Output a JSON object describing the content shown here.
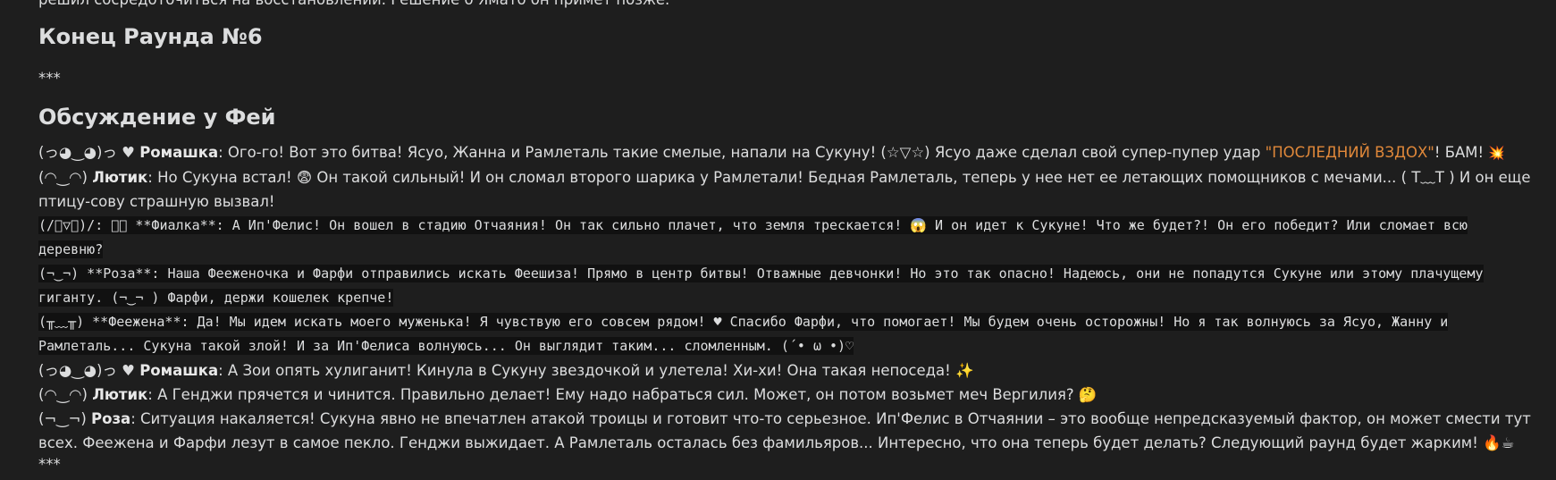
{
  "lead_text": "решил сосредоточиться на восстановлении. Решение о Ямато он примет позже.",
  "round_end_heading": "Конец Раунда №6",
  "separator": "***",
  "discussion_heading": "Обсуждение у Фей",
  "messages": [
    {
      "face": "(っ◕‿◕)っ ♥ ",
      "speaker": "Ромашка",
      "text_before": ": Ого-го! Вот это битва! Ясуо, Жанна и Рамлеталь такие смелые, напали на Сукуну! (☆▽☆) Ясуо даже сделал свой супер-пупер удар ",
      "highlight": "\"ПОСЛЕДНИЙ ВЗДОХ\"",
      "text_after": "! БАМ! ",
      "emoji": "💥"
    },
    {
      "face": "(◠‿◠) ",
      "speaker": "Лютик",
      "text": ": Но Сукуна встал! 😨 Он такой сильный! И он сломал второго шарика у Рамлетали! Бедная Рамлеталь, теперь у нее нет ее летающих помощников с мечами... ( T﹏T ) И он еще птицу-сову страшную вызвал!"
    },
    {
      "mono": "(/ﾟ▽ﾟ)/: ･ﾟ **Фиалка**: А Ип'Фелис! Он вошел в стадию Отчаяния! Он так сильно плачет, что земля трескается! 😱 И он идет к Сукуне! Что же будет?! Он его победит? Или сломает всю деревню?"
    },
    {
      "mono": "(¬‿¬) **Роза**: Наша Феежeночка и Фарфи отправились искать Феешиза! Прямо в центр битвы! Отважные девчонки! Но это так опасно! Надеюсь, они не попадутся Сукуне или этому плачущему гиганту. (¬‿¬ ) Фарфи, держи кошелек крепче!"
    },
    {
      "mono": "(╥﹏╥) **Феежена**: Да! Мы идем искать моего муженька! Я чувствую его совсем рядом! ♥ Спасибо Фарфи, что помогает! Мы будем очень осторожны! Но я так волнуюсь за Ясуо, Жанну и Рамлеталь... Сукуна такой злой! И за Ип'Фелиса волнуюсь... Он выглядит таким... сломленным. (´• ω •)♡"
    },
    {
      "face": "(っ◕‿◕)っ ♥ ",
      "speaker": "Ромашка",
      "text": ": А Зои опять хулиганит! Кинула в Сукуну звездочкой и улетела! Хи-хи! Она такая непоседа! ✨"
    },
    {
      "face": "(◠‿◠) ",
      "speaker": "Лютик",
      "text": ": А Генджи прячется и чинится. Правильно делает! Ему надо набраться сил. Может, он потом возьмет меч Вергилия? 🤔"
    },
    {
      "face": "(¬‿¬) ",
      "speaker": "Роза",
      "text": ": Ситуация накаляется! Сукуна явно не впечатлен атакой троицы и готовит что-то серьезное. Ип'Фелис в Отчаянии – это вообще непредсказуемый фактор, он может смести тут всех. Феежена и Фарфи лезут в самое пекло. Генджи выжидает. А Рамлеталь осталась без фамильяров... Интересно, что она теперь будет делать? Следующий раунд будет жарким! 🔥☕"
    }
  ],
  "end_separator": "***"
}
